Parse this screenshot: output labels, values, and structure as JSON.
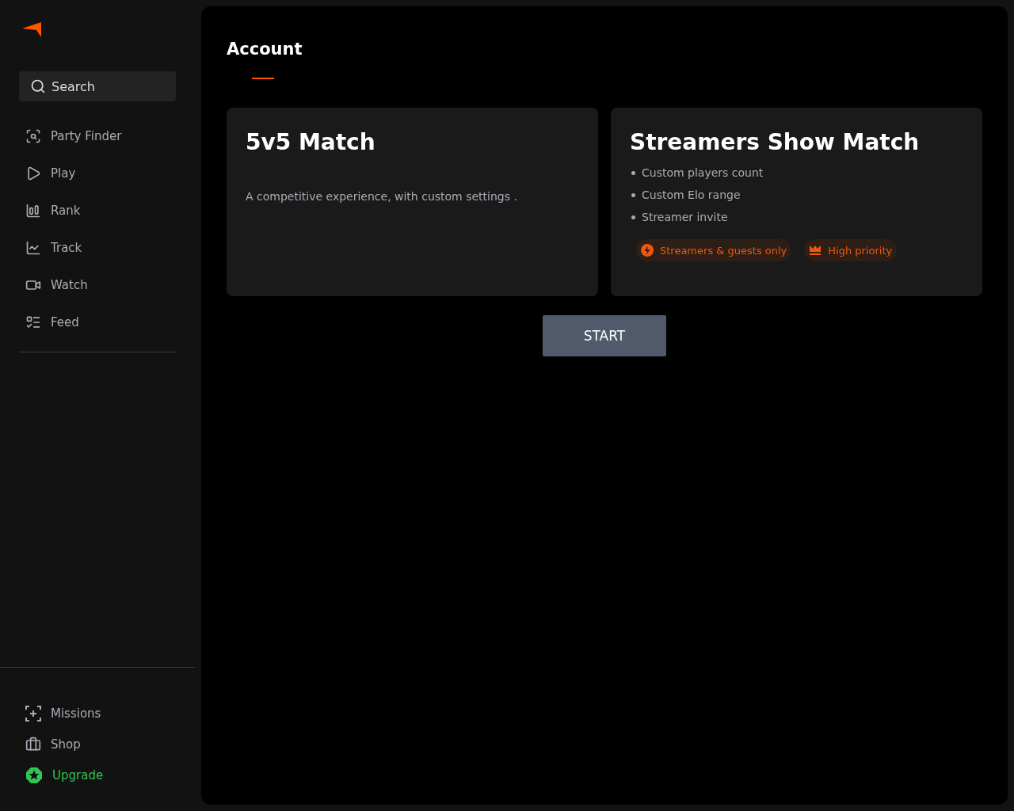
{
  "sidebar": {
    "search": {
      "placeholder": "Search"
    },
    "nav_items": [
      {
        "label": "Party Finder"
      },
      {
        "label": "Play"
      },
      {
        "label": "Rank"
      },
      {
        "label": "Track"
      },
      {
        "label": "Watch"
      },
      {
        "label": "Feed"
      }
    ],
    "bottom_items": [
      {
        "label": "Missions",
        "highlighted": false
      },
      {
        "label": "Shop",
        "highlighted": false
      },
      {
        "label": "Upgrade",
        "highlighted": true
      }
    ]
  },
  "main": {
    "title": "Account",
    "cards": [
      {
        "title": "5v5 Match",
        "description": "A competitive experience, with custom settings ."
      },
      {
        "title": "Streamers Show Match",
        "features": [
          "Custom players count",
          "Custom Elo range",
          "Streamer invite"
        ],
        "tags": [
          {
            "label": "Streamers & guests only"
          },
          {
            "label": "High priority"
          }
        ]
      }
    ],
    "start_button": "START"
  }
}
